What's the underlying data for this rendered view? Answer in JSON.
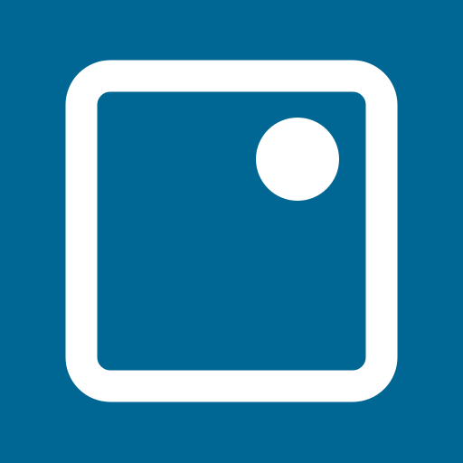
{
  "icon": {
    "name": "rounded-square-with-dot-icon",
    "background_color": "#006794",
    "foreground_color": "#FFFFFF"
  }
}
